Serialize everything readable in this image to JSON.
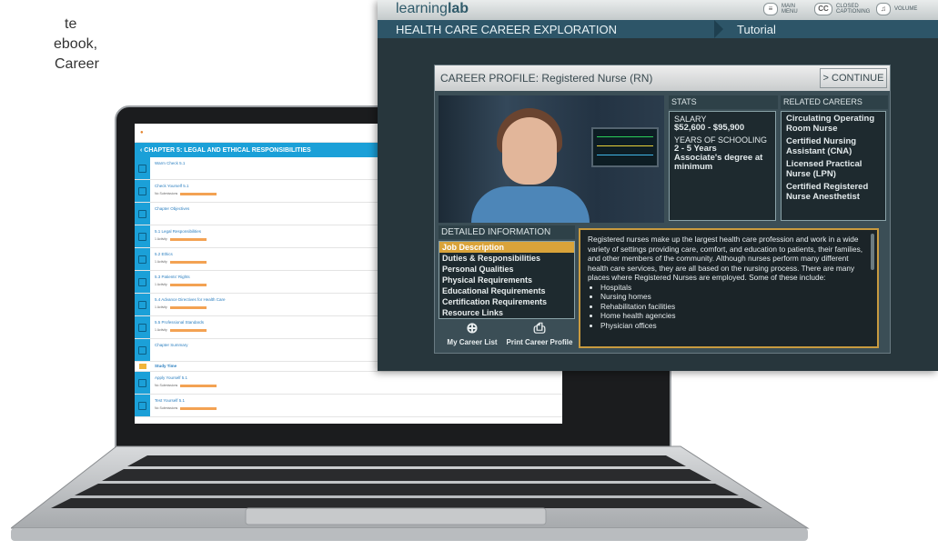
{
  "intro_text": [
    "te",
    "ebook,",
    "Career"
  ],
  "ebook": {
    "chapter_title": "CHAPTER 5: LEGAL AND ETHICAL RESPONSIBILITIES",
    "items": [
      {
        "text": "Warm Check 5.1",
        "sub": ""
      },
      {
        "text": "Check Yourself 5.1",
        "sub": "No Submissions"
      },
      {
        "text": "Chapter Objectives",
        "sub": ""
      },
      {
        "text": "5.1 Legal Responsibilities",
        "sub": "1 Activity"
      },
      {
        "text": "5.2 Ethics",
        "sub": "1 Activity"
      },
      {
        "text": "5.3 Patients' Rights",
        "sub": "1 Activity"
      },
      {
        "text": "5.4 Advance Directives for Health Care",
        "sub": "1 Activity"
      },
      {
        "text": "5.5 Professional Standards",
        "sub": "1 Activity"
      },
      {
        "text": "Chapter Summary",
        "sub": ""
      }
    ],
    "study_label": "Study Time",
    "study_items": [
      {
        "text": "Apply Yourself 5.1",
        "sub": "No Submissions"
      },
      {
        "text": "Test Yourself 5.1",
        "sub": "No Submissions"
      }
    ]
  },
  "app": {
    "logo_prefix": "learning",
    "logo_suffix": "lab",
    "main_menu": "MAIN MENU",
    "closed_captioning": "CLOSED CAPTIONING",
    "cc_icon": "CC",
    "volume": "VOLUME",
    "section_title": "HEALTH CARE CAREER EXPLORATION",
    "tutorial": "Tutorial"
  },
  "profile": {
    "title": "CAREER PROFILE: Registered Nurse (RN)",
    "continue_label": "> CONTINUE",
    "stats_header": "STATS",
    "salary_label": "SALARY",
    "salary_value": "$52,600 - $95,900",
    "schooling_label": "YEARS OF SCHOOLING",
    "schooling_value": "2 - 5 Years",
    "degree_value": "Associate's degree at minimum",
    "related_header": "RELATED CAREERS",
    "related": [
      "Circulating Operating Room Nurse",
      "Certified Nursing Assistant (CNA)",
      "Licensed Practical Nurse (LPN)",
      "Certified Registered Nurse Anesthetist"
    ],
    "detail_header": "DETAILED INFORMATION",
    "detail_items": [
      "Job Description",
      "Duties & Responsibilities",
      "Personal Qualities",
      "Physical Requirements",
      "Educational Requirements",
      "Certification Requirements",
      "Resource Links"
    ],
    "my_career_list": "My Career List",
    "print_profile": "Print Career Profile",
    "description": "Registered nurses make up the largest health care profession and work in a wide variety of settings providing care, comfort, and education to patients, their families, and other members of the community. Although nurses perform many different health care services, they are all based on the nursing process. There are many places where Registered Nurses are employed. Some of these include:",
    "bullets": [
      "Hospitals",
      "Nursing homes",
      "Rehabilitation facilities",
      "Home health agencies",
      "Physician offices"
    ]
  },
  "colors": {
    "accent_blue": "#1ba0d8",
    "gold": "#d9a33a",
    "dark_panel": "#27363c"
  }
}
